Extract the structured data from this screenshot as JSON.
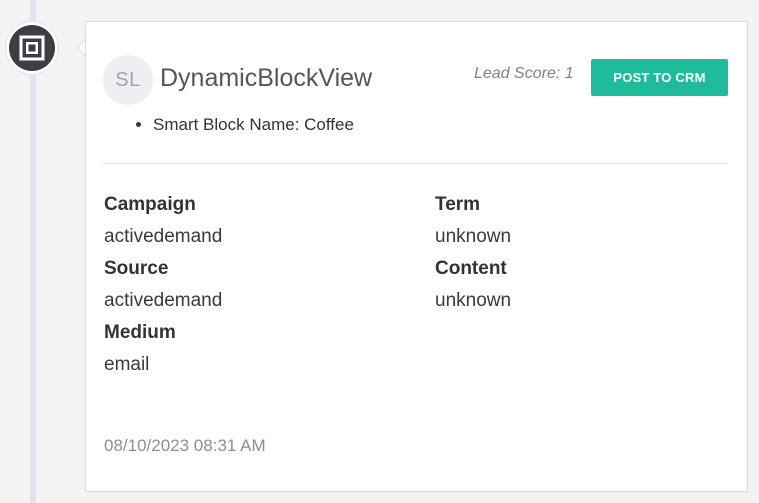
{
  "timeline": {
    "icon": "crop-frame-icon"
  },
  "activity": {
    "avatar_initials": "SL",
    "title": "DynamicBlockView",
    "lead_score": "Lead Score: 1",
    "post_button_label": "POST TO CRM",
    "details": [
      "Smart Block Name: Coffee"
    ],
    "fields": {
      "campaign": {
        "label": "Campaign",
        "value": "activedemand"
      },
      "source": {
        "label": "Source",
        "value": "activedemand"
      },
      "medium": {
        "label": "Medium",
        "value": "email"
      },
      "term": {
        "label": "Term",
        "value": "unknown"
      },
      "content": {
        "label": "Content",
        "value": "unknown"
      }
    },
    "timestamp": "08/10/2023 08:31 AM"
  },
  "colors": {
    "accent_button": "#1fbc9b",
    "icon_background": "#3b3f45",
    "timeline_line": "#dde4ee"
  }
}
